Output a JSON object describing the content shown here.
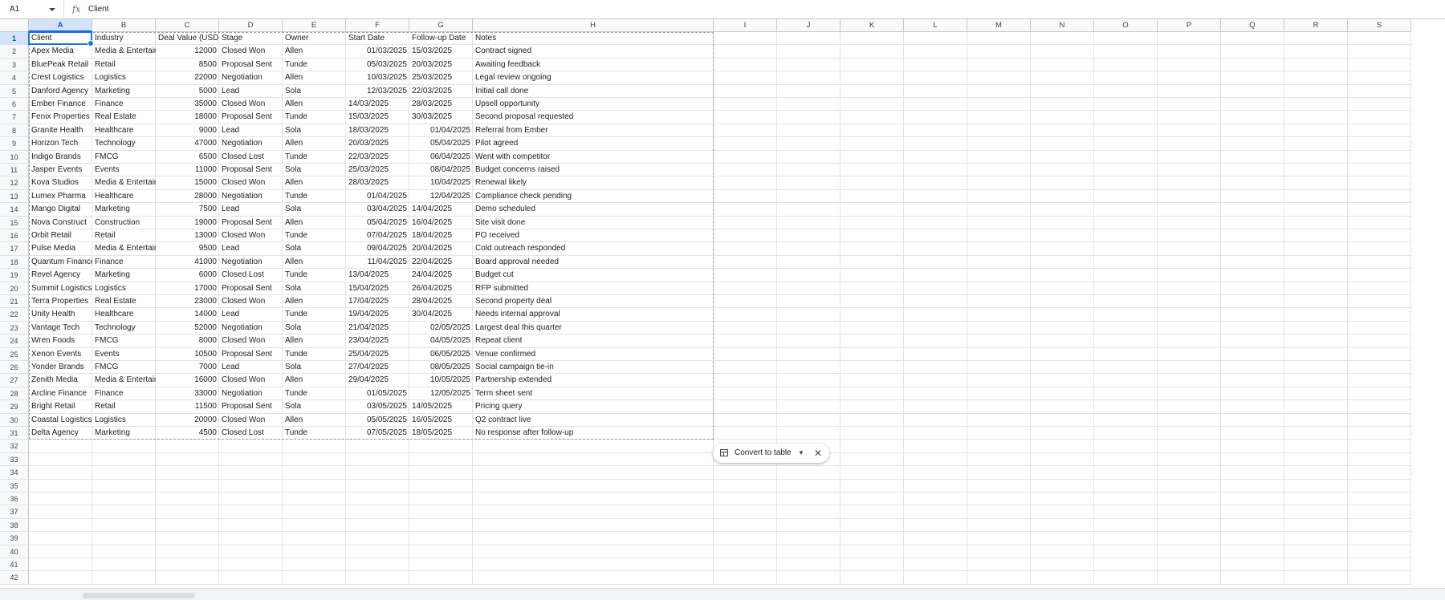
{
  "formula_bar": {
    "cell_ref": "A1",
    "fx_label": "fx",
    "value": "Client"
  },
  "columns": [
    "A",
    "B",
    "C",
    "D",
    "E",
    "F",
    "G",
    "H",
    "I",
    "J",
    "K",
    "L",
    "M",
    "N",
    "O",
    "P",
    "Q",
    "R",
    "S"
  ],
  "row_numbers": [
    "1",
    "2",
    "3",
    "4",
    "5",
    "6",
    "7",
    "8",
    "9",
    "10",
    "11",
    "12",
    "13",
    "14",
    "15",
    "16",
    "17",
    "18",
    "19",
    "20",
    "21",
    "22",
    "23",
    "24",
    "25",
    "26",
    "27",
    "28",
    "29",
    "30",
    "31",
    "32",
    "33",
    "34",
    "35",
    "36",
    "37",
    "38",
    "39",
    "40",
    "41",
    "42"
  ],
  "header_row": [
    "Client",
    "Industry",
    "Deal Value (USD)",
    "Stage",
    "Owner",
    "Start Date",
    "Follow-up Date",
    "Notes"
  ],
  "rows": [
    [
      "Apex Media",
      "Media & Entertainment",
      "12000",
      "Closed Won",
      "Allen",
      "01/03/2025",
      "15/03/2025",
      "Contract signed"
    ],
    [
      "BluePeak Retail",
      "Retail",
      "8500",
      "Proposal Sent",
      "Tunde",
      "05/03/2025",
      "20/03/2025",
      "Awaiting feedback"
    ],
    [
      "Crest Logistics",
      "Logistics",
      "22000",
      "Negotiation",
      "Allen",
      "10/03/2025",
      "25/03/2025",
      "Legal review ongoing"
    ],
    [
      "Danford Agency",
      "Marketing",
      "5000",
      "Lead",
      "Sola",
      "12/03/2025",
      "22/03/2025",
      "Initial call done"
    ],
    [
      "Ember Finance",
      "Finance",
      "35000",
      "Closed Won",
      "Allen",
      "14/03/2025",
      "28/03/2025",
      "Upsell opportunity"
    ],
    [
      "Fenix Properties",
      "Real Estate",
      "18000",
      "Proposal Sent",
      "Tunde",
      "15/03/2025",
      "30/03/2025",
      "Second proposal requested"
    ],
    [
      "Granite Health",
      "Healthcare",
      "9000",
      "Lead",
      "Sola",
      "18/03/2025",
      "01/04/2025",
      "Referral from Ember"
    ],
    [
      "Horizon Tech",
      "Technology",
      "47000",
      "Negotiation",
      "Allen",
      "20/03/2025",
      "05/04/2025",
      "Pilot agreed"
    ],
    [
      "Indigo Brands",
      "FMCG",
      "6500",
      "Closed Lost",
      "Tunde",
      "22/03/2025",
      "06/04/2025",
      "Went with competitor"
    ],
    [
      "Jasper Events",
      "Events",
      "11000",
      "Proposal Sent",
      "Sola",
      "25/03/2025",
      "08/04/2025",
      "Budget concerns raised"
    ],
    [
      "Kova Studios",
      "Media & Entertainment",
      "15000",
      "Closed Won",
      "Allen",
      "28/03/2025",
      "10/04/2025",
      "Renewal likely"
    ],
    [
      "Lumex Pharma",
      "Healthcare",
      "28000",
      "Negotiation",
      "Tunde",
      "01/04/2025",
      "12/04/2025",
      "Compliance check pending"
    ],
    [
      "Mango Digital",
      "Marketing",
      "7500",
      "Lead",
      "Sola",
      "03/04/2025",
      "14/04/2025",
      "Demo scheduled"
    ],
    [
      "Nova Construct",
      "Construction",
      "19000",
      "Proposal Sent",
      "Allen",
      "05/04/2025",
      "16/04/2025",
      "Site visit done"
    ],
    [
      "Orbit Retail",
      "Retail",
      "13000",
      "Closed Won",
      "Tunde",
      "07/04/2025",
      "18/04/2025",
      "PO received"
    ],
    [
      "Pulse Media",
      "Media & Entertainment",
      "9500",
      "Lead",
      "Sola",
      "09/04/2025",
      "20/04/2025",
      "Cold outreach responded"
    ],
    [
      "Quantum Finance",
      "Finance",
      "41000",
      "Negotiation",
      "Allen",
      "11/04/2025",
      "22/04/2025",
      "Board approval needed"
    ],
    [
      "Revel Agency",
      "Marketing",
      "6000",
      "Closed Lost",
      "Tunde",
      "13/04/2025",
      "24/04/2025",
      "Budget cut"
    ],
    [
      "Summit Logistics",
      "Logistics",
      "17000",
      "Proposal Sent",
      "Sola",
      "15/04/2025",
      "26/04/2025",
      "RFP submitted"
    ],
    [
      "Terra Properties",
      "Real Estate",
      "23000",
      "Closed Won",
      "Allen",
      "17/04/2025",
      "28/04/2025",
      "Second property deal"
    ],
    [
      "Unity Health",
      "Healthcare",
      "14000",
      "Lead",
      "Tunde",
      "19/04/2025",
      "30/04/2025",
      "Needs internal approval"
    ],
    [
      "Vantage Tech",
      "Technology",
      "52000",
      "Negotiation",
      "Sola",
      "21/04/2025",
      "02/05/2025",
      "Largest deal this quarter"
    ],
    [
      "Wren Foods",
      "FMCG",
      "8000",
      "Closed Won",
      "Allen",
      "23/04/2025",
      "04/05/2025",
      "Repeat client"
    ],
    [
      "Xenon Events",
      "Events",
      "10500",
      "Proposal Sent",
      "Tunde",
      "25/04/2025",
      "06/05/2025",
      "Venue confirmed"
    ],
    [
      "Yonder Brands",
      "FMCG",
      "7000",
      "Lead",
      "Sola",
      "27/04/2025",
      "08/05/2025",
      "Social campaign tie-in"
    ],
    [
      "Zenith Media",
      "Media & Entertainment",
      "16000",
      "Closed Won",
      "Allen",
      "29/04/2025",
      "10/05/2025",
      "Partnership extended"
    ],
    [
      "Arcline Finance",
      "Finance",
      "33000",
      "Negotiation",
      "Tunde",
      "01/05/2025",
      "12/05/2025",
      "Term sheet sent"
    ],
    [
      "Bright Retail",
      "Retail",
      "11500",
      "Proposal Sent",
      "Sola",
      "03/05/2025",
      "14/05/2025",
      "Pricing query"
    ],
    [
      "Coastal Logistics",
      "Logistics",
      "20000",
      "Closed Won",
      "Allen",
      "05/05/2025",
      "16/05/2025",
      "Q2 contract live"
    ],
    [
      "Delta Agency",
      "Marketing",
      "4500",
      "Closed Lost",
      "Tunde",
      "07/05/2025",
      "18/05/2025",
      "No response after follow-up"
    ]
  ],
  "right_aligned_cells": {
    "col_F_rows": [
      2,
      3,
      4,
      5,
      13,
      14,
      15,
      16,
      17,
      18,
      28,
      29,
      30,
      31
    ],
    "col_G_rows": [
      8,
      9,
      10,
      11,
      12,
      13,
      23,
      24,
      25,
      26,
      27,
      28
    ]
  },
  "convert_chip": {
    "label": "Convert to table"
  },
  "colors": {
    "selection": "#1a73e8",
    "header_bg": "#f8f9fa",
    "active_header_bg": "#d3e3fd"
  }
}
